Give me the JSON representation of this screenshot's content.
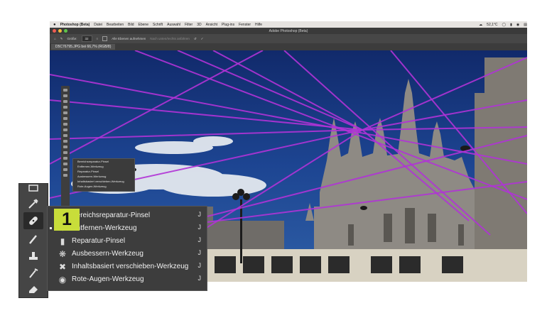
{
  "menubar": {
    "apple": "",
    "app": "Photoshop (Beta)",
    "items": [
      "Datei",
      "Bearbeiten",
      "Bild",
      "Ebene",
      "Schrift",
      "Auswahl",
      "Filter",
      "3D",
      "Ansicht",
      "Plug-ins",
      "Fenster",
      "Hilfe"
    ],
    "status": "52,1°C"
  },
  "window": {
    "title": "Adobe Photoshop (Beta)"
  },
  "options": {
    "size_label": "Größe:",
    "size_value": "32",
    "all_layers": "Alle Ebenen aufnehmen",
    "ghost_text": "Nach unten/rechts anfahren"
  },
  "document": {
    "tab": "D5C76795.JPG bei 66,7% (RGB/8)"
  },
  "flyout_small": [
    "Bereichsreparatur-Pinsel",
    "Entfernen-Werkzeug",
    "Reparatur-Pinsel",
    "Ausbessern-Werkzeug",
    "Inhaltsbasiert verschieben-Werkzeug",
    "Rote-Augen-Werkzeug"
  ],
  "flyout": {
    "shortcut": "J",
    "items": [
      {
        "label": "Bereichsreparatur-Pinsel",
        "icon": "spot-healing-icon"
      },
      {
        "label": "Entfernen-Werkzeug",
        "icon": "remove-tool-icon"
      },
      {
        "label": "Reparatur-Pinsel",
        "icon": "healing-brush-icon"
      },
      {
        "label": "Ausbessern-Werkzeug",
        "icon": "patch-tool-icon"
      },
      {
        "label": "Inhaltsbasiert verschieben-Werkzeug",
        "icon": "content-aware-move-icon"
      },
      {
        "label": "Rote-Augen-Werkzeug",
        "icon": "red-eye-icon"
      }
    ]
  },
  "badge": "1",
  "colors": {
    "selection_lines": "#b033d6",
    "sky": "#1c3c86",
    "badge": "#c8dd3a"
  }
}
